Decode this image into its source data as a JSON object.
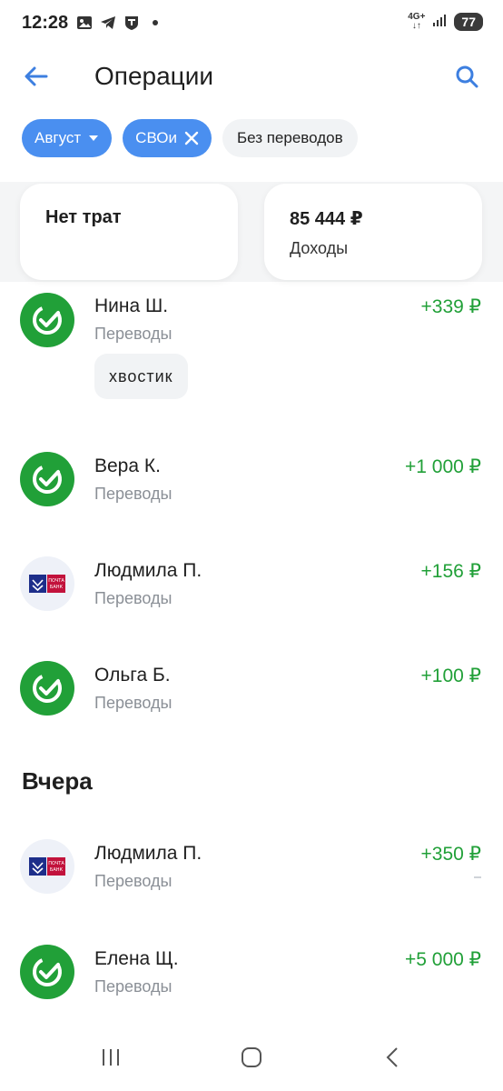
{
  "status_bar": {
    "time": "12:28",
    "network_top": "4G+",
    "network_bottom": "↓↑",
    "battery": "77"
  },
  "header": {
    "title": "Операции",
    "back_icon": "arrow-left-icon",
    "search_icon": "search-icon"
  },
  "filters": [
    {
      "label": "Август",
      "active": true,
      "icon": "chevron-down-icon"
    },
    {
      "label": "СВОи",
      "active": true,
      "icon": "close-icon"
    },
    {
      "label": "Без переводов",
      "active": false
    }
  ],
  "summary": {
    "expenses_label": "Нет трат",
    "income_value": "85 444 ₽",
    "income_label": "Доходы"
  },
  "transactions_today": [
    {
      "name": "Нина Ш.",
      "category": "Переводы",
      "amount": "+339 ₽",
      "avatar": "sber-logo",
      "tag": "хвостик"
    },
    {
      "name": "Вера К.",
      "category": "Переводы",
      "amount": "+1 000 ₽",
      "avatar": "sber-logo"
    },
    {
      "name": "Людмила П.",
      "category": "Переводы",
      "amount": "+156 ₽",
      "avatar": "pochta-bank-logo"
    },
    {
      "name": "Ольга Б.",
      "category": "Переводы",
      "amount": "+100 ₽",
      "avatar": "sber-logo"
    }
  ],
  "section_yesterday": "Вчера",
  "transactions_yesterday": [
    {
      "name": "Людмила П.",
      "category": "Переводы",
      "amount": "+350 ₽",
      "avatar": "pochta-bank-logo"
    },
    {
      "name": "Елена Щ.",
      "category": "Переводы",
      "amount": "+5 000 ₽",
      "avatar": "sber-logo"
    }
  ],
  "pochta_logo_text": [
    "ПОЧТА",
    "БАНК"
  ],
  "colors": {
    "accent": "#4a8ff0",
    "income_green": "#21a038",
    "secondary_text": "#8a8f96"
  }
}
